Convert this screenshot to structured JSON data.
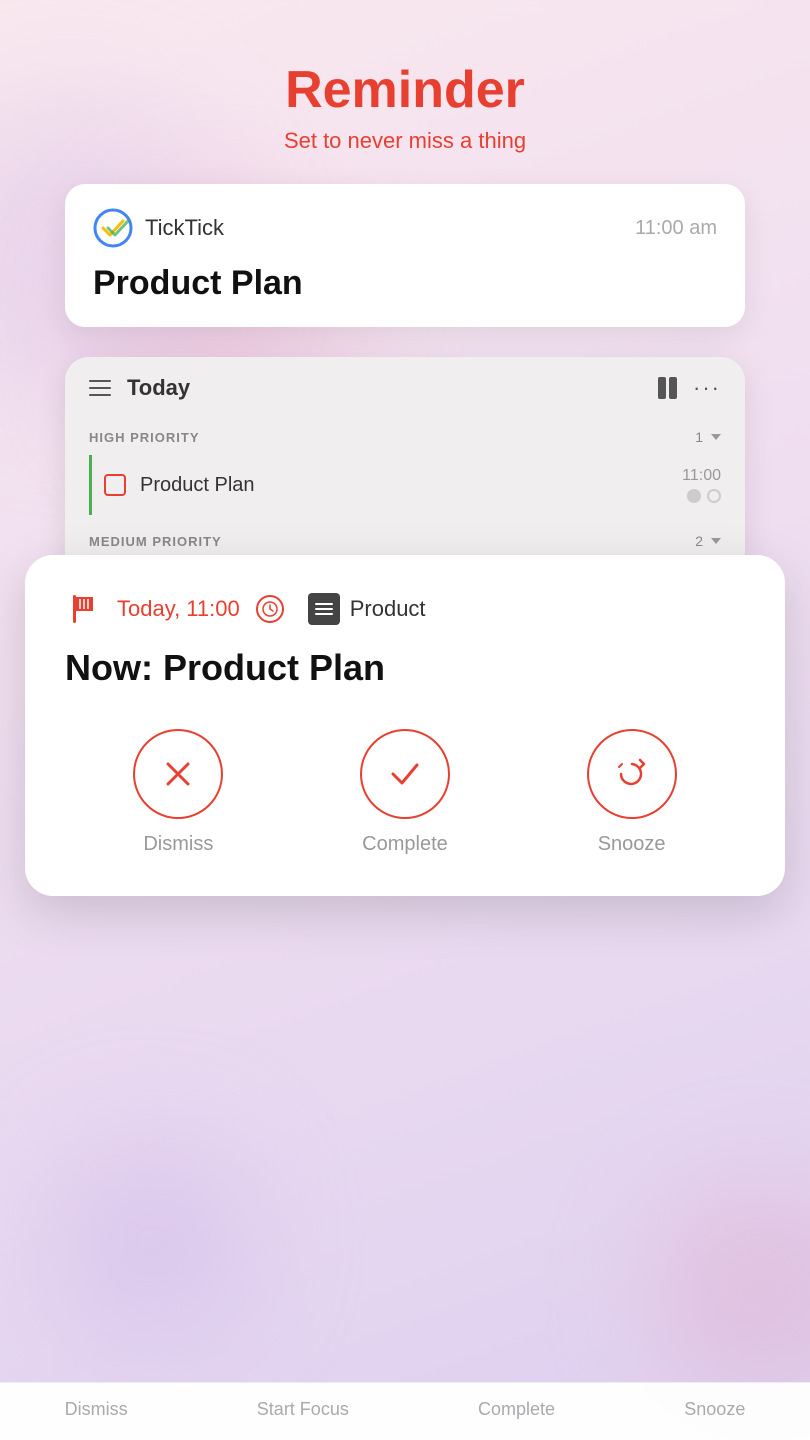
{
  "header": {
    "title": "Reminder",
    "subtitle": "Set to never miss a thing"
  },
  "notification_card": {
    "app_name": "TickTick",
    "time": "11:00 am",
    "task": "Product Plan"
  },
  "tasklist": {
    "header_label": "Today",
    "high_priority": {
      "label": "HIGH PRIORITY",
      "count": "1",
      "tasks": [
        {
          "name": "Product Plan",
          "time": "11:00"
        }
      ]
    },
    "medium_priority": {
      "label": "MEDIUM PRIORITY",
      "count": "2"
    }
  },
  "reminder": {
    "time": "Today, 11:00",
    "list_name": "Product",
    "task_title": "Now: Product Plan",
    "actions": {
      "dismiss": "Dismiss",
      "complete": "Complete",
      "snooze": "Snooze"
    }
  },
  "bottom_bar": {
    "dismiss": "Dismiss",
    "start_focus": "Start Focus",
    "complete": "Complete",
    "snooze": "Snooze"
  }
}
